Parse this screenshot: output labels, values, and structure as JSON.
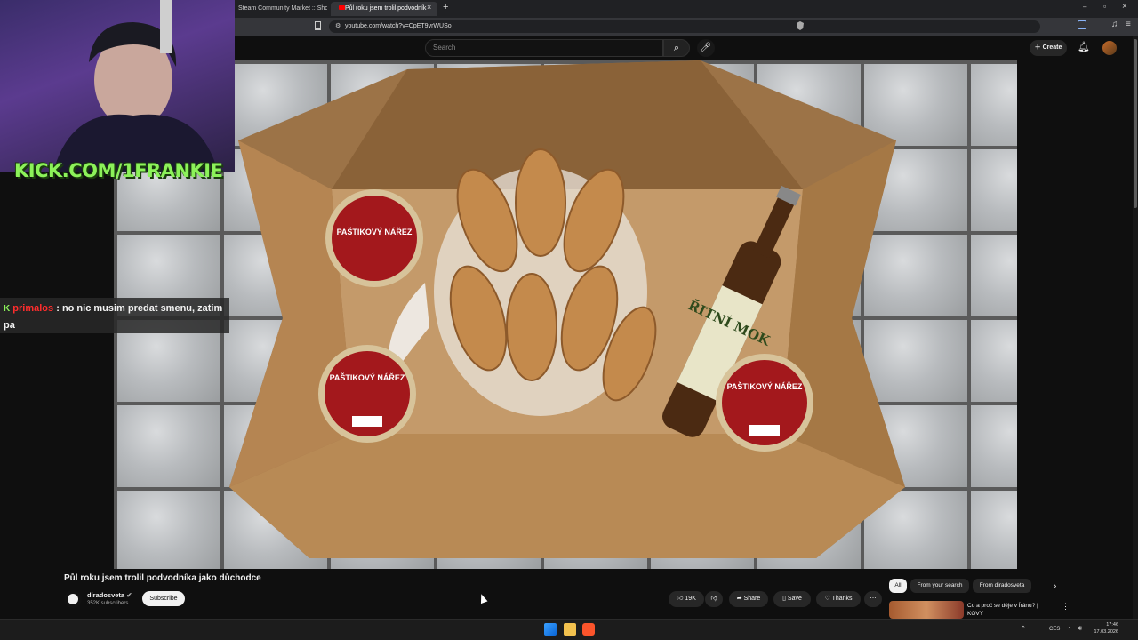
{
  "browser": {
    "tabs": [
      {
        "label": "Steam Community Market :: Showing"
      },
      {
        "label": "Půl roku jsem trolil podvodník"
      }
    ],
    "new_tab": "+",
    "url": "youtube.com/watch?v=CpET9vrWUSo",
    "window_controls": [
      "–",
      "▫",
      "×"
    ]
  },
  "youtube_header": {
    "search_placeholder": "Search",
    "create_label": "Create"
  },
  "overlay": {
    "kick_text": "KICK.COM/1FRANKIE",
    "chat": {
      "username": "primalos",
      "message": ": no nic musim predat smenu, zatim pa",
      "username_color": "#ff2d2d"
    }
  },
  "video_art": {
    "can_label_1": "PAŠTIKOVÝ NÁŘEZ",
    "can_label_2": "PAŠTIKOVÝ NÁŘEZ",
    "can_label_3": "PAŠTIKOVÝ NÁŘEZ",
    "bottle_label": "ŘITNÍ MOK"
  },
  "video_meta": {
    "title": "Půl roku jsem trolil podvodníka jako důchodce",
    "channel": "diradosveta",
    "subscribers": "352K subscribers",
    "subscribe_label": "Subscribe",
    "likes": "19K",
    "share_label": "Share",
    "save_label": "Save",
    "thanks_label": "Thanks"
  },
  "related": {
    "chips": [
      "All",
      "From your search",
      "From diradosveta"
    ],
    "first_video_title": "Co a proč se děje v Íránu? | KOVY"
  },
  "taskbar": {
    "lang": "CES",
    "time": "17:46",
    "date": "17.03.2026"
  },
  "colors": {
    "kick_green": "#8cf25a",
    "youtube_bg": "#0f0f0f"
  }
}
